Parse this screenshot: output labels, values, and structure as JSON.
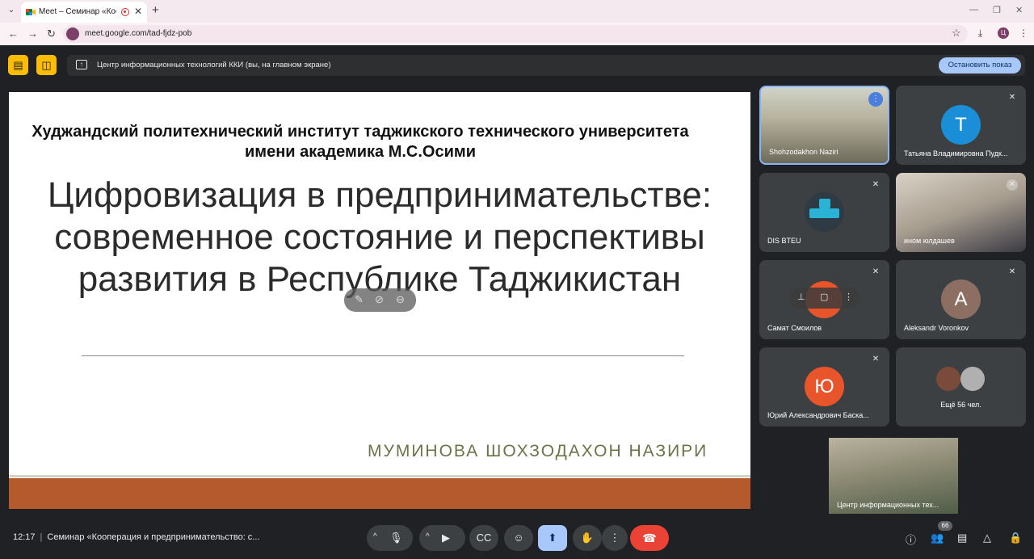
{
  "browser": {
    "tab_title": "Meet – Семинар «Коопера",
    "url": "meet.google.com/tad-fjdz-pob",
    "profile_initial": "Ц"
  },
  "meet": {
    "presentation_banner": "Центр информационных технологий ККИ (вы, на главном экране)",
    "stop_presenting_label": "Остановить показ"
  },
  "slide": {
    "institution": "Худжандский политехнический институт таджикского технического университета имени академика М.С.Осими",
    "title": "Цифровизация в предпринимательстве: современное состояние и перспективы развития в Республике Таджикистан",
    "author": "МУМИНОВА ШОХЗОДАХОН НАЗИРИ"
  },
  "participants": [
    {
      "name": "Shohzodakhon Naziri",
      "speaking": true
    },
    {
      "name": "Татьяна Владимировна Пудк...",
      "initial": "Т",
      "color": "#1a8fd8"
    },
    {
      "name": "DIS BTEU"
    },
    {
      "name": "ином юлдашев"
    },
    {
      "name": "Самат Смоилов"
    },
    {
      "name": "Aleksandr Voronkov",
      "initial": "А",
      "color": "#8d6e63"
    },
    {
      "name": "Юрий Александрович Баска...",
      "initial": "Ю",
      "color": "#e8552b"
    }
  ],
  "more_participants": "Ещё 56 чел.",
  "self_view_name": "Центр информационных тех...",
  "bottom": {
    "time": "12:17",
    "meeting_title": "Семинар «Кооперация и предпринимательство: с...",
    "participant_count": "66"
  },
  "colors": {
    "accent": "#a8c7fa",
    "end_call": "#ea4335",
    "slide_band": "#b55a2c",
    "author_text": "#6d7348"
  }
}
